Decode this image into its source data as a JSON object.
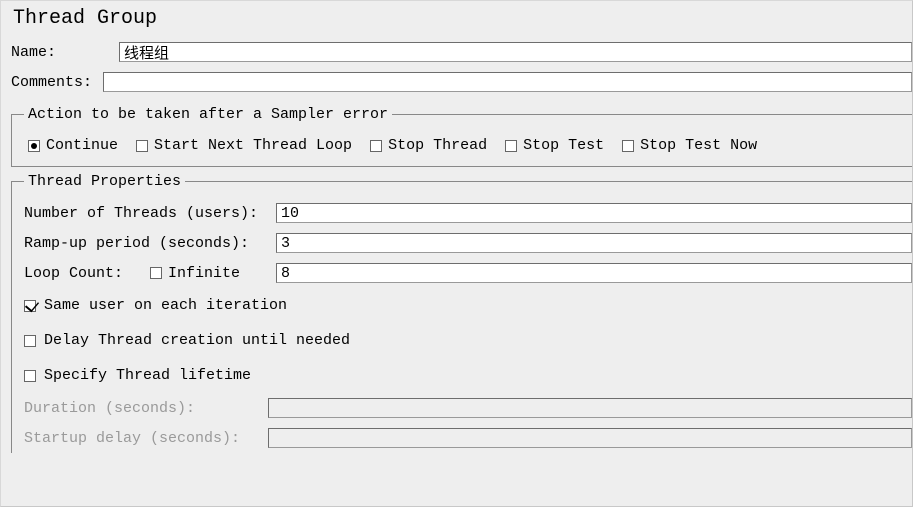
{
  "title": "Thread Group",
  "name": {
    "label": "Name:",
    "value": "线程组"
  },
  "comments": {
    "label": "Comments:",
    "value": ""
  },
  "samplerError": {
    "legend": "Action to be taken after a Sampler error",
    "options": {
      "continue": "Continue",
      "startNext": "Start Next Thread Loop",
      "stopThread": "Stop Thread",
      "stopTest": "Stop Test",
      "stopTestNow": "Stop Test Now"
    },
    "selected": "continue"
  },
  "threadProps": {
    "legend": "Thread Properties",
    "numThreads": {
      "label": "Number of Threads (users):",
      "value": "10"
    },
    "rampUp": {
      "label": "Ramp-up period (seconds):",
      "value": "3"
    },
    "loopCount": {
      "label": "Loop Count:",
      "infiniteLabel": "Infinite",
      "infinite": false,
      "value": "8"
    },
    "sameUser": {
      "label": "Same user on each iteration",
      "checked": true
    },
    "delayCreation": {
      "label": "Delay Thread creation until needed",
      "checked": false
    },
    "specifyLifetime": {
      "label": "Specify Thread lifetime",
      "checked": false
    },
    "duration": {
      "label": "Duration (seconds):",
      "value": ""
    },
    "startupDelay": {
      "label": "Startup delay (seconds):",
      "value": ""
    }
  }
}
